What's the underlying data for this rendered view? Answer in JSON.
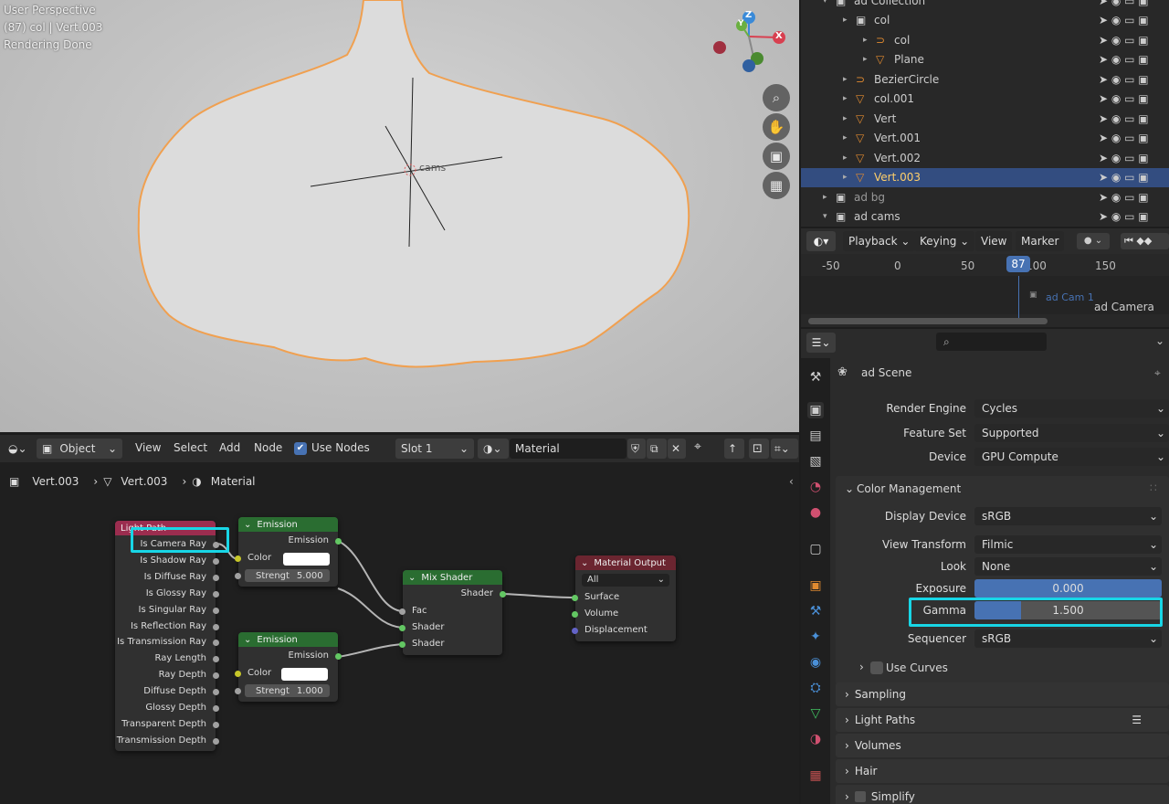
{
  "viewport": {
    "line1": "User Perspective",
    "line2": "(87) col | Vert.003",
    "line3": "Rendering Done",
    "camera_label": "cams",
    "gizmo": {
      "x": "X",
      "y": "Y",
      "z": "Z"
    },
    "nav_icons": [
      "zoom-icon",
      "hand-icon",
      "camera-icon",
      "grid-icon"
    ]
  },
  "outliner": {
    "rows": [
      {
        "label": "ad Collection",
        "indent": 0
      },
      {
        "label": "col",
        "indent": 1
      },
      {
        "label": "col",
        "indent": 2
      },
      {
        "label": "Plane",
        "indent": 2
      },
      {
        "label": "BezierCircle",
        "indent": 1
      },
      {
        "label": "col.001",
        "indent": 1
      },
      {
        "label": "Vert",
        "indent": 1
      },
      {
        "label": "Vert.001",
        "indent": 1
      },
      {
        "label": "Vert.002",
        "indent": 1
      },
      {
        "label": "Vert.003",
        "indent": 1,
        "selected": true
      },
      {
        "label": "ad bg",
        "indent": 0
      },
      {
        "label": "ad cams",
        "indent": 0
      }
    ]
  },
  "timeline": {
    "menus": [
      "Playback",
      "Keying",
      "View",
      "Marker"
    ],
    "ticks": [
      "-50",
      "0",
      "50",
      "100",
      "150"
    ],
    "current_frame": "87",
    "markers": [
      "ad Cam 1",
      "ad Camera"
    ]
  },
  "node_editor": {
    "mode": "Object",
    "menus": [
      "View",
      "Select",
      "Add",
      "Node"
    ],
    "use_nodes_label": "Use Nodes",
    "slot": "Slot 1",
    "material": "Material",
    "breadcrumb": [
      "Vert.003",
      "Vert.003",
      "Material"
    ],
    "nodes": {
      "light_path": {
        "title": "Light Path",
        "outputs": [
          "Is Camera Ray",
          "Is Shadow Ray",
          "Is Diffuse Ray",
          "Is Glossy Ray",
          "Is Singular Ray",
          "Is Reflection Ray",
          "Is Transmission Ray",
          "Ray Length",
          "Ray Depth",
          "Diffuse Depth",
          "Glossy Depth",
          "Transparent Depth",
          "Transmission Depth"
        ]
      },
      "emission1": {
        "title": "Emission",
        "output": "Emission",
        "color_label": "Color",
        "strength_label": "Strengt",
        "strength": "5.000"
      },
      "emission2": {
        "title": "Emission",
        "output": "Emission",
        "color_label": "Color",
        "strength_label": "Strengt",
        "strength": "1.000"
      },
      "mix": {
        "title": "Mix Shader",
        "output": "Shader",
        "inputs": [
          "Fac",
          "Shader",
          "Shader"
        ]
      },
      "output": {
        "title": "Material Output",
        "target": "All",
        "inputs": [
          "Surface",
          "Volume",
          "Displacement"
        ]
      }
    }
  },
  "properties": {
    "scene": "ad Scene",
    "render_engine_label": "Render Engine",
    "render_engine": "Cycles",
    "feature_set_label": "Feature Set",
    "feature_set": "Supported",
    "device_label": "Device",
    "device": "GPU Compute",
    "color_management": "Color Management",
    "display_device_label": "Display Device",
    "display_device": "sRGB",
    "view_transform_label": "View Transform",
    "view_transform": "Filmic",
    "look_label": "Look",
    "look": "None",
    "exposure_label": "Exposure",
    "exposure": "0.000",
    "gamma_label": "Gamma",
    "gamma": "1.500",
    "gamma_fill": 0.25,
    "sequencer_label": "Sequencer",
    "sequencer": "sRGB",
    "use_curves": "Use Curves",
    "panels": [
      "Sampling",
      "Light Paths",
      "Volumes",
      "Hair",
      "Simplify"
    ]
  },
  "colors": {
    "highlight": "#18d6e6",
    "selected": "#334d80",
    "accent": "#4772b3"
  }
}
